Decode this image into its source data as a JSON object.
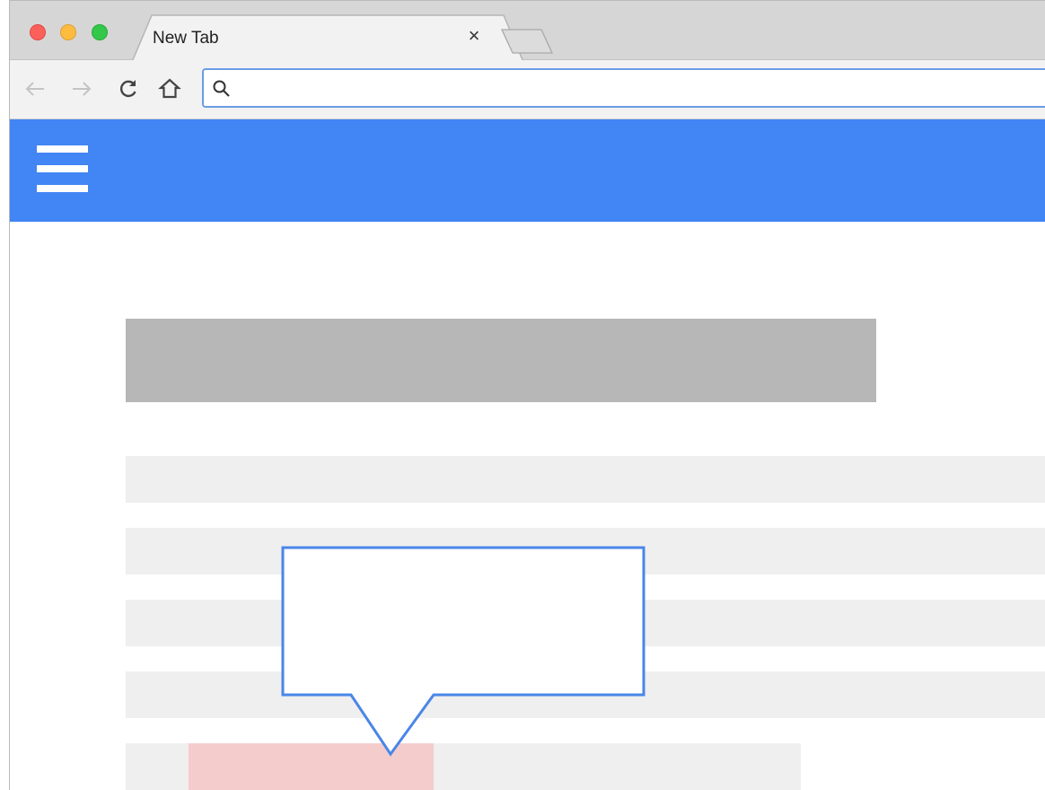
{
  "browser": {
    "tab_title": "New Tab",
    "tab_close_glyph": "×",
    "address_value": "",
    "address_placeholder": ""
  },
  "icons": {
    "back": "arrow-left-icon",
    "forward": "arrow-right-icon",
    "reload": "reload-icon",
    "home": "home-icon",
    "search": "search-icon",
    "menu": "hamburger-menu-icon"
  },
  "colors": {
    "app_bar": "#4285f4",
    "title_placeholder": "#b7b7b7",
    "line_placeholder": "#efefef",
    "highlight": "#f4cccc",
    "callout_border": "#4a86e8"
  },
  "content": {
    "placeholder_line_count": 5,
    "highlighted_line_index": 4
  }
}
